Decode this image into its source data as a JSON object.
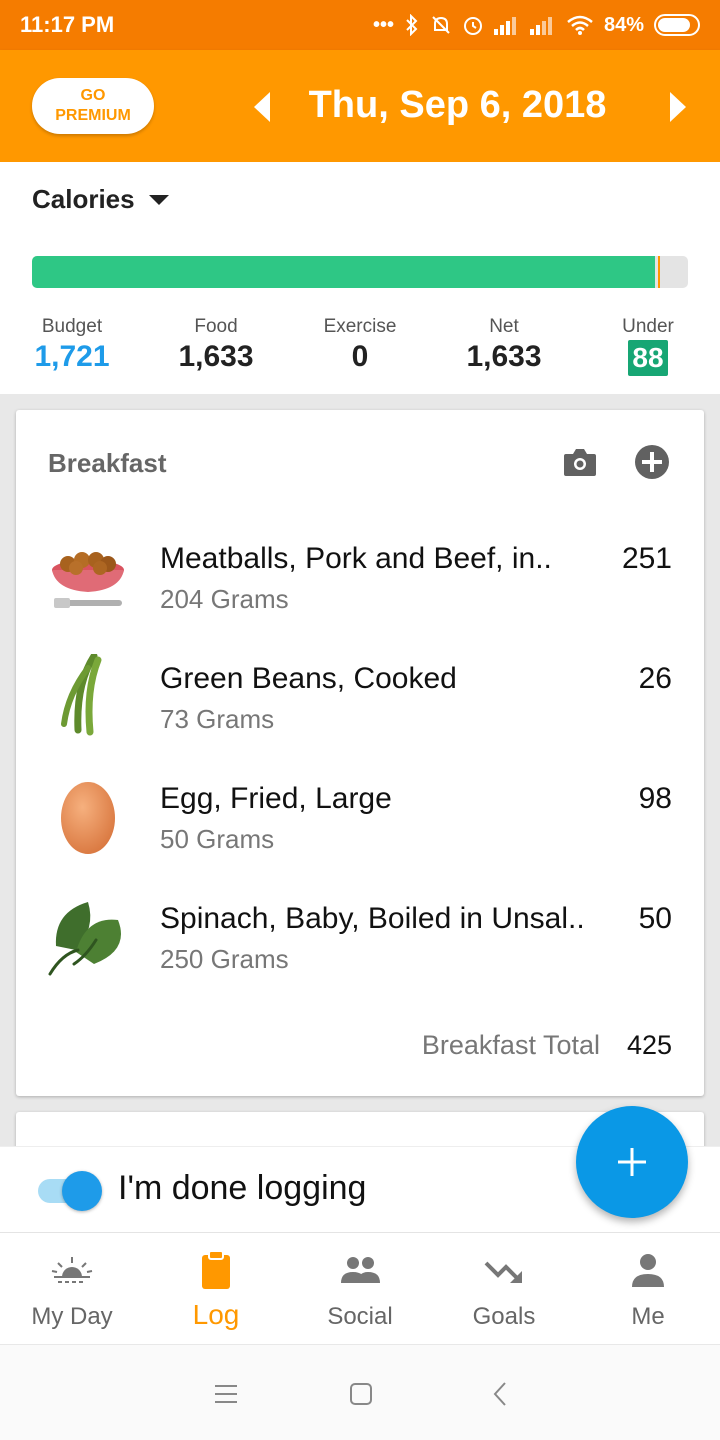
{
  "status_bar": {
    "time": "11:17 PM",
    "battery": "84%",
    "battery_level": 0.84
  },
  "header": {
    "premium_line1": "GO",
    "premium_line2": "PREMIUM",
    "date": "Thu, Sep 6, 2018",
    "prev_icon": "chevron-left-icon",
    "next_icon": "chevron-right-icon"
  },
  "summary": {
    "metric": "Calories",
    "progress_fraction": 0.949,
    "budget_marker_fraction": 0.955,
    "stats": {
      "budget_label": "Budget",
      "budget_value": "1,721",
      "food_label": "Food",
      "food_value": "1,633",
      "exercise_label": "Exercise",
      "exercise_value": "0",
      "net_label": "Net",
      "net_value": "1,633",
      "under_label": "Under",
      "under_value": "88"
    },
    "colors": {
      "progress": "#2ec785",
      "budget_blue": "#1e9be9",
      "under_badge": "#17a674"
    }
  },
  "meal": {
    "title": "Breakfast",
    "items": [
      {
        "name": "Meatballs, Pork and Beef, in..",
        "qty": "204 Grams",
        "calories": "251",
        "icon": "meatballs-icon"
      },
      {
        "name": "Green Beans, Cooked",
        "qty": "73 Grams",
        "calories": "26",
        "icon": "green-beans-icon"
      },
      {
        "name": "Egg, Fried, Large",
        "qty": "50 Grams",
        "calories": "98",
        "icon": "egg-icon"
      },
      {
        "name": "Spinach, Baby, Boiled in Unsal..",
        "qty": "250 Grams",
        "calories": "50",
        "icon": "spinach-icon"
      }
    ],
    "total_label": "Breakfast Total",
    "total_value": "425"
  },
  "done_logging": {
    "label": "I'm done logging",
    "checked": true
  },
  "nav": {
    "items": [
      {
        "label": "My Day",
        "icon": "sunrise-icon"
      },
      {
        "label": "Log",
        "icon": "clipboard-icon",
        "active": true
      },
      {
        "label": "Social",
        "icon": "people-icon"
      },
      {
        "label": "Goals",
        "icon": "trend-down-icon"
      },
      {
        "label": "Me",
        "icon": "person-icon"
      }
    ],
    "active_color": "#ff9800"
  },
  "brand_colors": {
    "header": "#ff9800",
    "status_bar": "#f57c00",
    "fab": "#0a98e6"
  }
}
